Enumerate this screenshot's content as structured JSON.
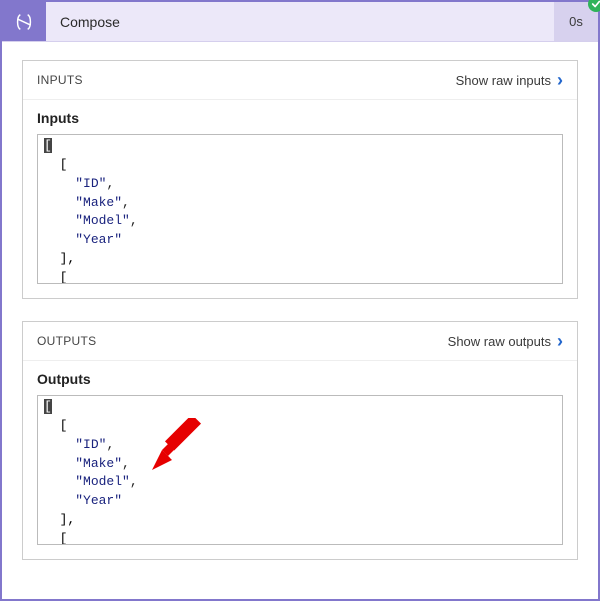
{
  "header": {
    "title": "Compose",
    "duration": "0s",
    "status": "success"
  },
  "panels": {
    "inputs": {
      "section_label": "INPUTS",
      "raw_link": "Show raw inputs",
      "subtitle": "Inputs",
      "json_lines": [
        {
          "sym": "[",
          "indent": 0,
          "cursor": true
        },
        {
          "sym": "[",
          "indent": 1
        },
        {
          "str": "ID",
          "trail": ",",
          "indent": 2
        },
        {
          "str": "Make",
          "trail": ",",
          "indent": 2
        },
        {
          "str": "Model",
          "trail": ",",
          "indent": 2
        },
        {
          "str": "Year",
          "indent": 2
        },
        {
          "sym": "],",
          "indent": 1
        },
        {
          "sym": "[",
          "indent": 1
        }
      ]
    },
    "outputs": {
      "section_label": "OUTPUTS",
      "raw_link": "Show raw outputs",
      "subtitle": "Outputs",
      "json_lines": [
        {
          "sym": "[",
          "indent": 0,
          "cursor": true
        },
        {
          "sym": "[",
          "indent": 1
        },
        {
          "str": "ID",
          "trail": ",",
          "indent": 2
        },
        {
          "str": "Make",
          "trail": ",",
          "indent": 2
        },
        {
          "str": "Model",
          "trail": ",",
          "indent": 2
        },
        {
          "str": "Year",
          "indent": 2
        },
        {
          "sym": "],",
          "indent": 1
        },
        {
          "sym": "[",
          "indent": 1
        }
      ]
    }
  },
  "colors": {
    "accent": "#8277cc",
    "header_bg": "#ece8f9",
    "header_right_bg": "#d7d1ee",
    "success": "#2fb35a",
    "link_chevron": "#2266cc",
    "json_string": "#1a237e",
    "arrow": "#e60000"
  }
}
